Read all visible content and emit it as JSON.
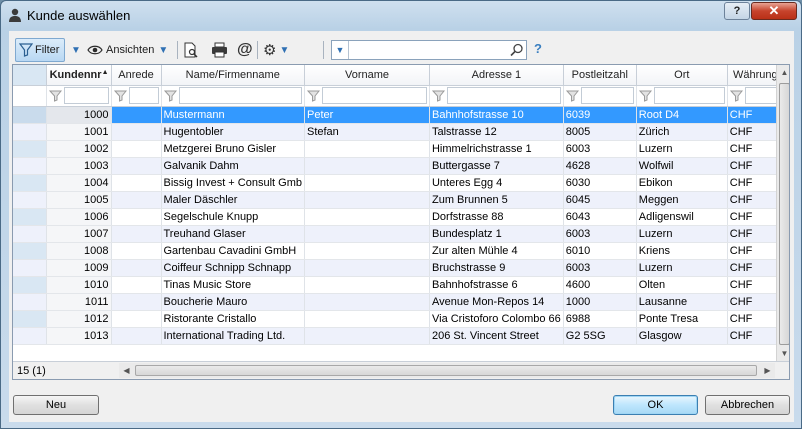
{
  "window": {
    "title": "Kunde auswählen",
    "help_label": "?",
    "close_label": "✕"
  },
  "toolbar": {
    "filter_label": "Filter",
    "views_label": "Ansichten",
    "search_value": "",
    "help_label": "?"
  },
  "grid": {
    "columns": [
      "Kundennr",
      "Anrede",
      "Name/Firmenname",
      "Vorname",
      "Adresse 1",
      "Postleitzahl",
      "Ort",
      "Währung"
    ],
    "rows": [
      [
        "1000",
        "",
        "Mustermann",
        "Peter",
        "Bahnhofstrasse 10",
        "6039",
        "Root D4",
        "CHF"
      ],
      [
        "1001",
        "",
        "Hugentobler",
        "Stefan",
        "Talstrasse 12",
        "8005",
        "Zürich",
        "CHF"
      ],
      [
        "1002",
        "",
        "Metzgerei Bruno Gisler",
        "",
        "Himmelrichstrasse 1",
        "6003",
        "Luzern",
        "CHF"
      ],
      [
        "1003",
        "",
        "Galvanik Dahm",
        "",
        "Buttergasse 7",
        "4628",
        "Wolfwil",
        "CHF"
      ],
      [
        "1004",
        "",
        "Bissig Invest + Consult Gmb",
        "",
        "Unteres Egg 4",
        "6030",
        "Ebikon",
        "CHF"
      ],
      [
        "1005",
        "",
        "Maler Däschler",
        "",
        "Zum Brunnen 5",
        "6045",
        "Meggen",
        "CHF"
      ],
      [
        "1006",
        "",
        "Segelschule Knupp",
        "",
        "Dorfstrasse 88",
        "6043",
        "Adligenswil",
        "CHF"
      ],
      [
        "1007",
        "",
        "Treuhand Glaser",
        "",
        "Bundesplatz 1",
        "6003",
        "Luzern",
        "CHF"
      ],
      [
        "1008",
        "",
        "Gartenbau Cavadini GmbH",
        "",
        "Zur alten Mühle 4",
        "6010",
        "Kriens",
        "CHF"
      ],
      [
        "1009",
        "",
        "Coiffeur Schnipp Schnapp",
        "",
        "Bruchstrasse 9",
        "6003",
        "Luzern",
        "CHF"
      ],
      [
        "1010",
        "",
        "Tinas Music Store",
        "",
        "Bahnhofstrasse 6",
        "4600",
        "Olten",
        "CHF"
      ],
      [
        "1011",
        "",
        "Boucherie Mauro",
        "",
        "Avenue Mon-Repos 14",
        "1000",
        "Lausanne",
        "CHF"
      ],
      [
        "1012",
        "",
        "Ristorante Cristallo",
        "",
        "Via Cristoforo Colombo 66",
        "6988",
        "Ponte Tresa",
        "CHF"
      ],
      [
        "1013",
        "",
        "International Trading Ltd.",
        "",
        "206 St. Vincent Street",
        "G2 5SG",
        "Glasgow",
        "CHF"
      ]
    ],
    "selected_row": 0,
    "record_count": "15 (1)"
  },
  "footer": {
    "new_label": "Neu",
    "ok_label": "OK",
    "cancel_label": "Abbrechen"
  },
  "colors": {
    "selection": "#3399ff",
    "alt_row": "#eef1fb",
    "accent": "#2f70b3"
  }
}
